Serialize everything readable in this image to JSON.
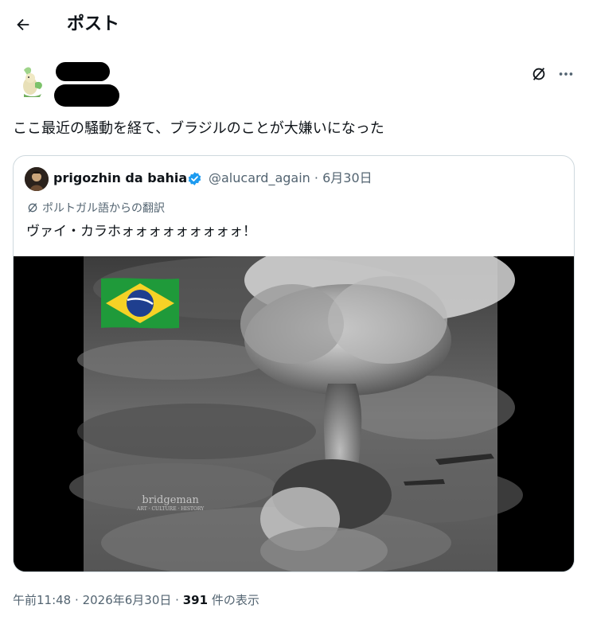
{
  "header": {
    "title": "ポスト",
    "back_icon": "arrow-left-icon"
  },
  "post": {
    "text": "ここ最近の騒動を経て、ブラジルのことが大嫌いになった",
    "actions": {
      "translate_icon": "translate-icon",
      "more_icon": "more-icon"
    }
  },
  "quote": {
    "name": "prigozhin da bahia",
    "handle": "@alucard_again",
    "date": "6月30日",
    "separator": "·",
    "translated_label": "ポルトガル語からの翻訳",
    "text": "ヴァイ・カラホォォォォォォォォォ！",
    "media": {
      "watermark": "bridgeman",
      "watermark_sub": "ART · CULTURE · HISTORY"
    }
  },
  "footer": {
    "time": "午前11:48",
    "date": "2026年6月30日",
    "separator": "·",
    "views": "391",
    "views_label": "件の表示"
  }
}
